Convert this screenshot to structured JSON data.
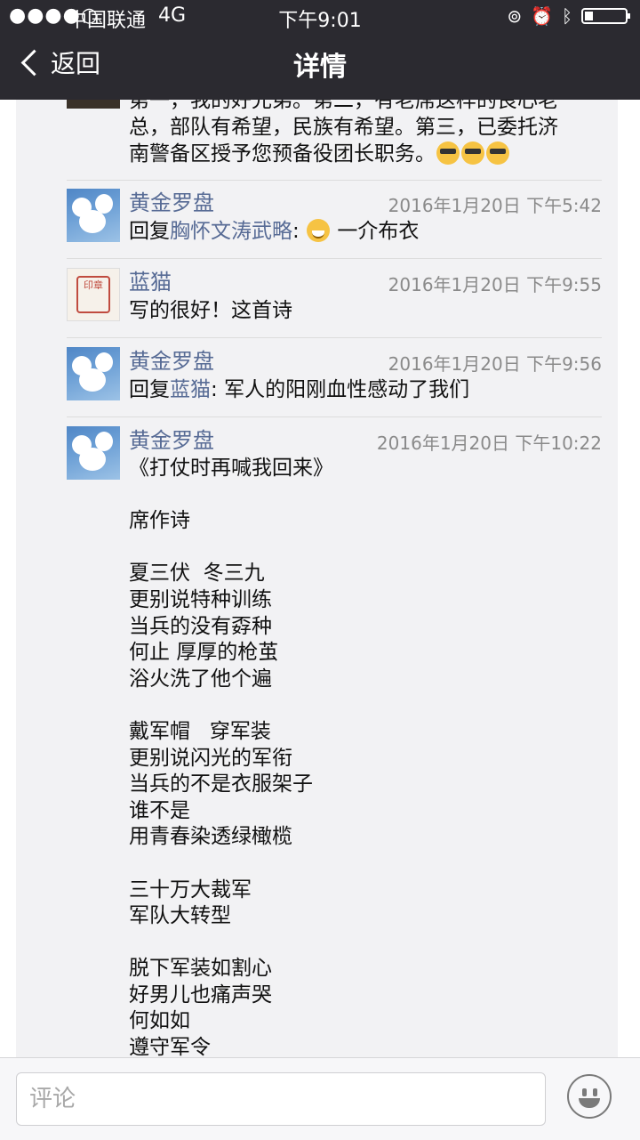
{
  "status_bar": {
    "signal": "●●●●○",
    "carrier": "中国联通",
    "network": "4G",
    "time": "下午9:01",
    "icons": [
      "rotation-lock-icon",
      "alarm-icon",
      "bluetooth-icon",
      "battery-icon"
    ],
    "battery_level": 0.2
  },
  "nav": {
    "back_label": "返回",
    "title": "详情"
  },
  "comments": {
    "partial": {
      "lines": [
        "第一，我的好兄弟。第二，有老席这样的良心老",
        "总，部队有希望，民族有希望。第三，已委托济",
        "南警备区授予您预备役团长职务。"
      ]
    },
    "items": [
      {
        "name": "黄金罗盘",
        "time": "2016年1月20日 下午5:42",
        "reply_prefix": "回复",
        "reply_to": "胸怀文涛武略",
        "sep": ": ",
        "text": " 一介布衣"
      },
      {
        "name": "蓝猫",
        "time": "2016年1月20日 下午9:55",
        "text": "写的很好！这首诗"
      },
      {
        "name": "黄金罗盘",
        "time": "2016年1月20日 下午9:56",
        "reply_prefix": "回复",
        "reply_to": "蓝猫",
        "sep": ": ",
        "text": "军人的阳刚血性感动了我们"
      },
      {
        "name": "黄金罗盘",
        "time": "2016年1月20日 下午10:22"
      }
    ],
    "seal_text": "印章",
    "poem_lines": [
      "《打仗时再喊我回来》",
      "",
      "席作诗",
      "",
      "夏三伏  冬三九",
      "更别说特种训练",
      "当兵的没有孬种",
      "何止 厚厚的枪茧",
      "浴火洗了他个遍",
      "",
      "戴军帽   穿军装",
      "更别说闪光的军衔",
      "当兵的不是衣服架子",
      "谁不是",
      "用青春染透绿橄榄",
      "",
      "三十万大裁军",
      "军队大转型",
      "",
      "脱下军装如割心",
      "好男儿也痛声哭",
      "何如如",
      "遵守军令"
    ]
  },
  "input": {
    "placeholder": "评论"
  },
  "colors": {
    "nav_bg": "#2b2a30",
    "name_blue": "#576b95",
    "panel_bg": "#f2f2f4"
  }
}
